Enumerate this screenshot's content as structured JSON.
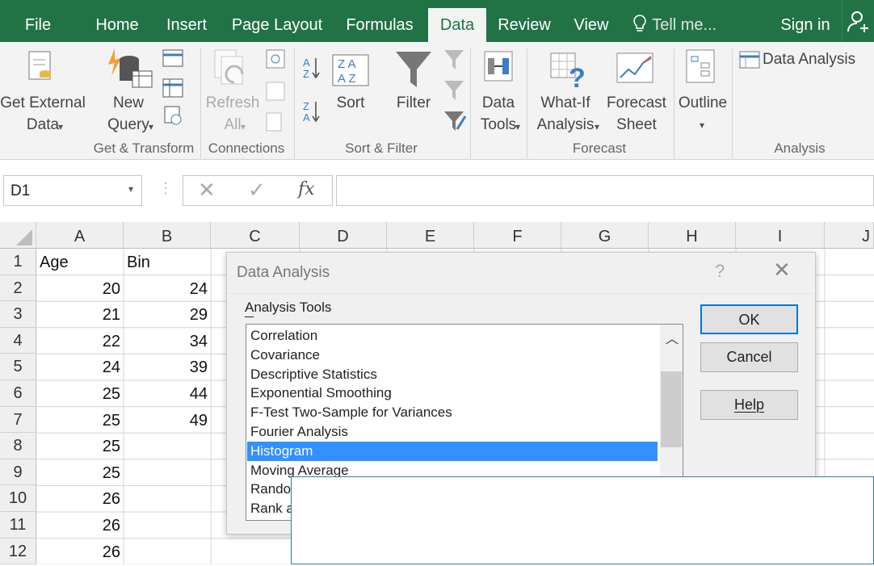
{
  "tabs": {
    "file": "File",
    "home": "Home",
    "insert": "Insert",
    "page_layout": "Page Layout",
    "formulas": "Formulas",
    "data": "Data",
    "review": "Review",
    "view": "View",
    "tell_me": "Tell me...",
    "sign_in": "Sign in"
  },
  "ribbon": {
    "get_external_data": "Get External\nData",
    "new_query": "New\nQuery",
    "refresh_all": "Refresh\nAll",
    "sort": "Sort",
    "filter": "Filter",
    "data_tools": "Data\nTools",
    "what_if": "What-If\nAnalysis",
    "forecast_sheet": "Forecast\nSheet",
    "outline": "Outline",
    "data_analysis": "Data Analysis",
    "groups": {
      "get_transform": "Get & Transform",
      "connections": "Connections",
      "sort_filter": "Sort & Filter",
      "forecast": "Forecast",
      "analysis": "Analysis"
    }
  },
  "formula_bar": {
    "name_box": "D1",
    "fx": "fx",
    "value": ""
  },
  "columns": [
    "A",
    "B",
    "C",
    "D",
    "E",
    "F",
    "G",
    "H",
    "I",
    "J"
  ],
  "rows": [
    "1",
    "2",
    "3",
    "4",
    "5",
    "6",
    "7",
    "8",
    "9",
    "10",
    "11",
    "12"
  ],
  "cells": {
    "A": [
      "Age",
      "20",
      "21",
      "22",
      "24",
      "25",
      "25",
      "25",
      "25",
      "26",
      "26",
      "26"
    ],
    "B": [
      "Bin",
      "24",
      "29",
      "34",
      "39",
      "44",
      "49",
      "",
      "",
      "",
      "",
      ""
    ]
  },
  "dialog": {
    "title": "Data Analysis",
    "help_glyph": "?",
    "label": "Analysis Tools",
    "items": [
      "Correlation",
      "Covariance",
      "Descriptive Statistics",
      "Exponential Smoothing",
      "F-Test Two-Sample for Variances",
      "Fourier Analysis",
      "Histogram",
      "Moving Average",
      "Rando",
      "Rank a"
    ],
    "selected_item": "Histogram",
    "ok": "OK",
    "cancel": "Cancel",
    "help": "Help"
  },
  "colors": {
    "excel_green": "#217346",
    "selection_blue": "#3390ff",
    "dialog_accent": "#2d7fa8"
  }
}
